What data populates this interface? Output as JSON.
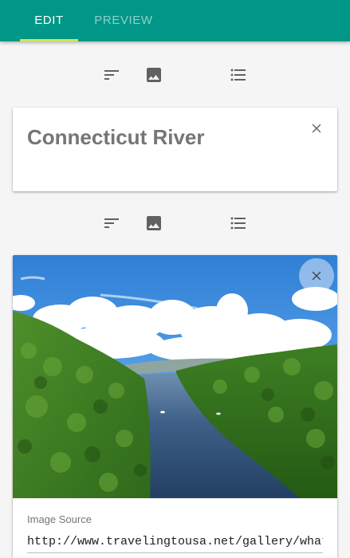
{
  "tabs": {
    "edit": "EDIT",
    "preview": "PREVIEW",
    "active": "edit"
  },
  "toolbar_icons": [
    "text-format-icon",
    "image-icon",
    "list-icon"
  ],
  "title_block": {
    "text": "Connecticut River",
    "close": "×"
  },
  "image_block": {
    "close": "×",
    "source_label": "Image Source",
    "source_value": "http://www.travelingtousa.net/gallery/what-to-v"
  },
  "colors": {
    "appbar": "#009688",
    "tab_indicator": "#d4e157",
    "icon": "#616161",
    "title_text": "#757575"
  }
}
